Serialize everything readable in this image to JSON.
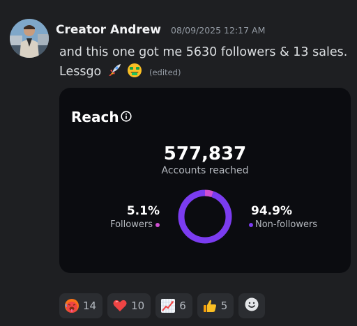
{
  "message": {
    "author": "Creator Andrew",
    "timestamp": "08/09/2025 12:17 AM",
    "text_line1": "and this one got me 5630 followers & 13 sales.",
    "text_line2": "Lessgo",
    "emojis": [
      "rocket-emoji",
      "money-mouth-face-emoji"
    ],
    "edited_label": "(edited)"
  },
  "card": {
    "title": "Reach",
    "total": "577,837",
    "total_caption": "Accounts reached",
    "left_percent": "5.1%",
    "left_label": "Followers",
    "right_percent": "94.9%",
    "right_label": "Non-followers",
    "colors": {
      "followers": "#d04fd1",
      "non_followers": "#7b3cf0",
      "background": "#0b0c10"
    }
  },
  "chart_data": {
    "type": "pie",
    "categories": [
      "Followers",
      "Non-followers"
    ],
    "values": [
      5.1,
      94.9
    ],
    "title": "Reach"
  },
  "reactions": [
    {
      "emoji": "hot-face-emoji",
      "count": "14"
    },
    {
      "emoji": "red-heart-emoji",
      "count": "10"
    },
    {
      "emoji": "chart-increasing-emoji",
      "count": "6"
    },
    {
      "emoji": "thumbs-up-emoji",
      "count": "5"
    }
  ],
  "add_reaction_icon": "smiley-add-icon"
}
